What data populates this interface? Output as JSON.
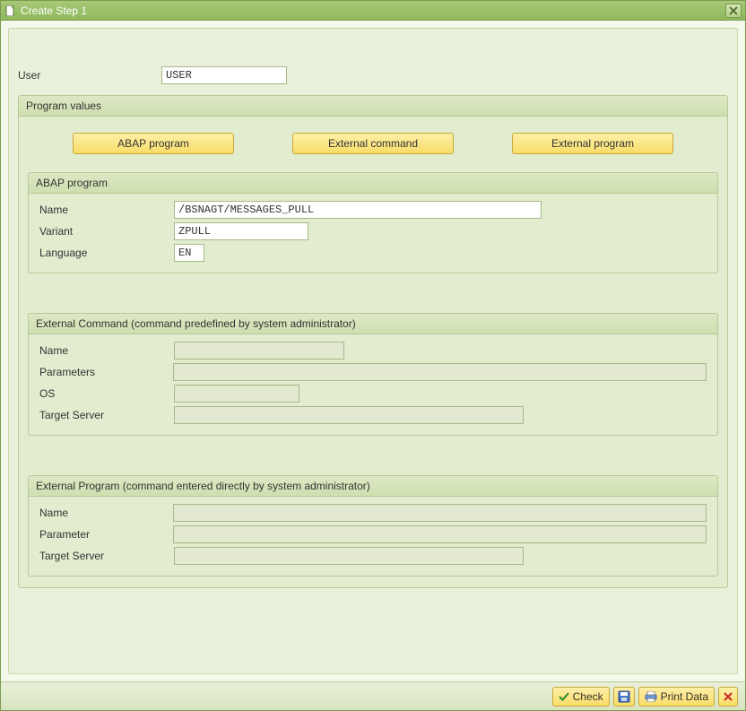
{
  "window": {
    "title": "Create Step  1"
  },
  "user": {
    "label": "User",
    "value": "USER"
  },
  "programValues": {
    "header": "Program values",
    "buttons": {
      "abap": "ABAP program",
      "extCmd": "External command",
      "extProg": "External program"
    }
  },
  "abapProgram": {
    "header": "ABAP program",
    "name": {
      "label": "Name",
      "value": "/BSNAGT/MESSAGES_PULL"
    },
    "variant": {
      "label": "Variant",
      "value": "ZPULL"
    },
    "language": {
      "label": "Language",
      "value": "EN"
    }
  },
  "externalCommand": {
    "header": "External Command (command predefined by system administrator)",
    "name": {
      "label": "Name",
      "value": ""
    },
    "parameters": {
      "label": "Parameters",
      "value": ""
    },
    "os": {
      "label": "OS",
      "value": ""
    },
    "targetServer": {
      "label": "Target Server",
      "value": ""
    }
  },
  "externalProgram": {
    "header": "External Program (command entered directly by system administrator)",
    "name": {
      "label": "Name",
      "value": ""
    },
    "parameter": {
      "label": "Parameter",
      "value": ""
    },
    "targetServer": {
      "label": "Target Server",
      "value": ""
    }
  },
  "footer": {
    "check": "Check",
    "printData": "Print Data"
  }
}
